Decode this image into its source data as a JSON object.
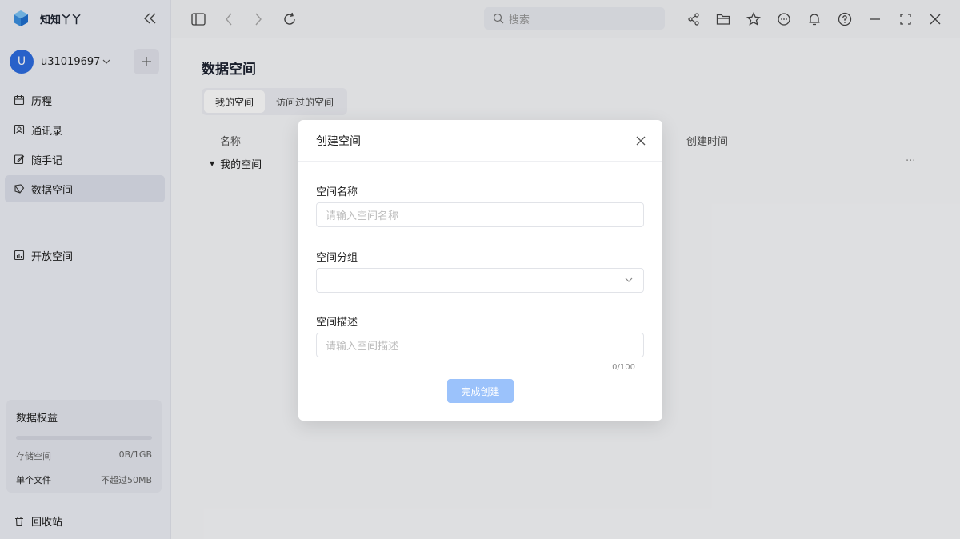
{
  "app": {
    "name": "知知丫丫"
  },
  "user": {
    "initial": "U",
    "name": "u31019697"
  },
  "sidebar": {
    "items": [
      {
        "label": "历程",
        "icon": "calendar-icon"
      },
      {
        "label": "通讯录",
        "icon": "contacts-icon"
      },
      {
        "label": "随手记",
        "icon": "edit-icon"
      },
      {
        "label": "数据空间",
        "icon": "data-space-icon",
        "active": true
      }
    ],
    "items2": [
      {
        "label": "开放空间",
        "icon": "chart-box-icon"
      }
    ],
    "quota": {
      "title": "数据权益",
      "storage_label": "存储空间",
      "storage_value": "0B/1GB",
      "storage_used_fraction": 0,
      "file_label": "单个文件",
      "file_value": "不超过50MB"
    },
    "recycle": "回收站"
  },
  "toolbar": {
    "search_placeholder": "搜索"
  },
  "main": {
    "title": "数据空间",
    "tabs": [
      {
        "label": "我的空间",
        "active": true
      },
      {
        "label": "访问过的空间",
        "active": false
      }
    ],
    "columns": {
      "name": "名称",
      "created": "创建时间"
    },
    "row": {
      "label": "我的空间",
      "more": "···"
    }
  },
  "modal": {
    "title": "创建空间",
    "name_label": "空间名称",
    "name_placeholder": "请输入空间名称",
    "group_label": "空间分组",
    "group_value": "",
    "desc_label": "空间描述",
    "desc_placeholder": "请输入空间描述",
    "desc_counter": "0/100",
    "submit_label": "完成创建"
  },
  "colors": {
    "accent": "#2d6ce0",
    "submit_disabled": "#9bc2fb"
  }
}
